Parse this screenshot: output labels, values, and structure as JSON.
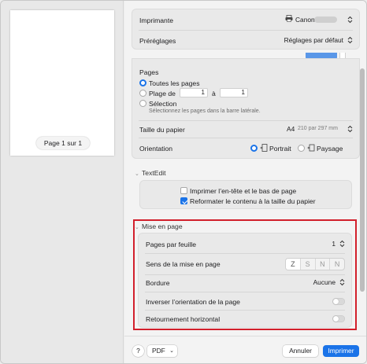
{
  "preview": {
    "page_indicator": "Page 1 sur 1"
  },
  "printer": {
    "label": "Imprimante",
    "value": "Canon"
  },
  "presets": {
    "label": "Préréglages",
    "value": "Réglages par défaut"
  },
  "pages": {
    "title": "Pages",
    "all_pages": "Toutes les pages",
    "range_label": "Plage de",
    "range_from": "1",
    "range_to_label": "à",
    "range_to": "1",
    "selection_label": "Sélection",
    "selection_hint": "Sélectionnez les pages dans la barre latérale.",
    "selected": "all"
  },
  "paper_size": {
    "label": "Taille du papier",
    "value": "A4",
    "dimensions": "210 par 297 mm"
  },
  "orientation": {
    "label": "Orientation",
    "portrait": "Portrait",
    "landscape": "Paysage",
    "selected": "portrait"
  },
  "textedit": {
    "title": "TextEdit",
    "header_footer": "Imprimer l’en-tête et le bas de page",
    "header_footer_checked": false,
    "rewrap": "Reformater le contenu à la taille du papier",
    "rewrap_checked": true
  },
  "layout": {
    "title": "Mise en page",
    "pages_per_sheet_label": "Pages par feuille",
    "pages_per_sheet_value": "1",
    "direction_label": "Sens de la mise en page",
    "direction_options": [
      "Z",
      "S",
      "N",
      "N"
    ],
    "direction_selected": 0,
    "border_label": "Bordure",
    "border_value": "Aucune",
    "reverse_orientation_label": "Inverser l’orientation de la page",
    "reverse_orientation_on": false,
    "flip_horizontal_label": "Retournement horizontal",
    "flip_horizontal_on": false
  },
  "footer": {
    "help": "?",
    "pdf": "PDF",
    "cancel": "Annuler",
    "print": "Imprimer"
  },
  "colors": {
    "accent": "#1a73e8",
    "highlight": "#d2202c"
  }
}
